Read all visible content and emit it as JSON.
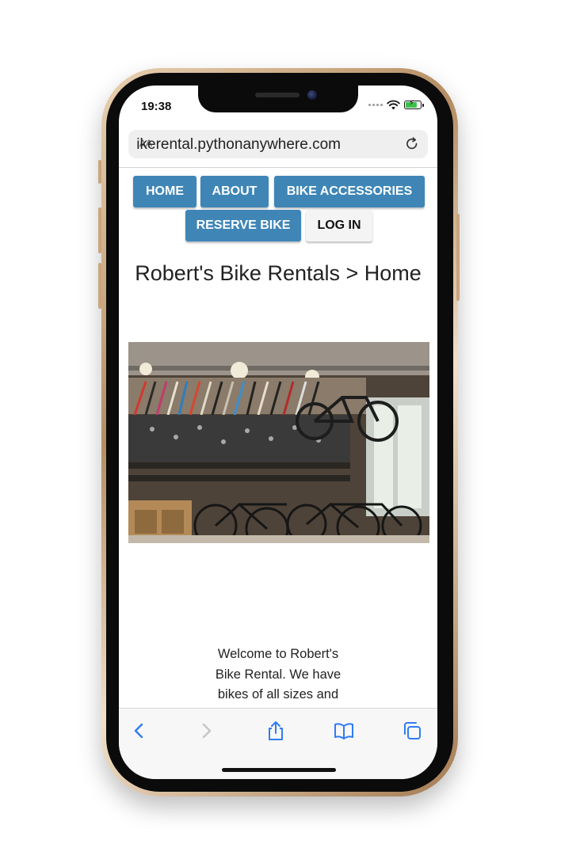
{
  "status_bar": {
    "time": "19:38"
  },
  "browser": {
    "aa_label": "AA",
    "url": "ikerental.pythonanywhere.com"
  },
  "nav": {
    "home": "HOME",
    "about": "ABOUT",
    "bike_accessories": "BIKE ACCESSORIES",
    "reserve_bike": "RESERVE BIKE",
    "log_in": "LOG IN"
  },
  "page": {
    "title": "Robert's Bike Rentals > Home",
    "welcome_text": "Welcome to Robert's Bike Rental. We have bikes of all sizes and accessories for you and your loved ones. Explore the local neighborhood in style accessories for you"
  },
  "colors": {
    "nav_button": "#3f86b7",
    "login_button": "#f4f4f4",
    "phone_frame": "#c9a57e",
    "safari_blue": "#2f7cf6"
  },
  "icons": {
    "back": "chevron-left-icon",
    "forward": "chevron-right-icon",
    "share": "share-icon",
    "bookmarks": "book-icon",
    "tabs": "tabs-icon",
    "reload": "reload-icon"
  }
}
